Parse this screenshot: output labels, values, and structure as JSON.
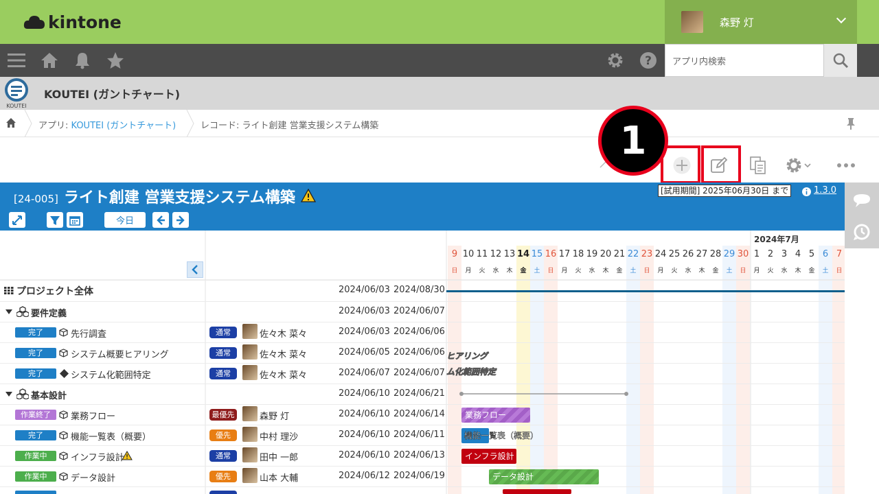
{
  "header": {
    "brand": "kintone",
    "user_name": "森野 灯"
  },
  "nav": {
    "search_placeholder": "アプリ内検索"
  },
  "app": {
    "title": "KOUTEI (ガントチャート)",
    "icon_label": "KOUTEI"
  },
  "breadcrumb": {
    "app_prefix": "アプリ: ",
    "app_link": "KOUTEI (ガントチャート)",
    "record": "レコード: ライト創建 営業支援システム構築"
  },
  "callout": {
    "number": "1"
  },
  "banner": {
    "record_id": "[24-005]",
    "title": "ライト創建 営業支援システム構築",
    "today_button": "今日",
    "trial_text": "[試用期間] 2025年06月30日 まで",
    "version": "1.3.0"
  },
  "gantt_header": {
    "month_label": "2024年7月",
    "days": [
      "9",
      "10",
      "11",
      "12",
      "13",
      "14",
      "15",
      "16",
      "17",
      "18",
      "19",
      "20",
      "21",
      "22",
      "23",
      "24",
      "25",
      "26",
      "27",
      "28",
      "29",
      "30",
      "1",
      "2",
      "3",
      "4",
      "5",
      "6",
      "7"
    ],
    "weekdays": [
      "日",
      "月",
      "火",
      "水",
      "木",
      "金",
      "土",
      "日",
      "月",
      "火",
      "水",
      "木",
      "金",
      "土",
      "日",
      "月",
      "火",
      "水",
      "木",
      "金",
      "土",
      "日",
      "月",
      "火",
      "水",
      "木",
      "金",
      "土",
      "日"
    ]
  },
  "rows": [
    {
      "name": "プロジェクト全体",
      "start": "2024/06/03",
      "end": "2024/08/30"
    },
    {
      "name": "要件定義",
      "start": "2024/06/03",
      "end": "2024/06/07"
    },
    {
      "status": "完了",
      "name": "先行調査",
      "priority": "通常",
      "person": "佐々木 菜々",
      "start": "2024/06/03",
      "end": "2024/06/06"
    },
    {
      "status": "完了",
      "name": "システム概要ヒアリング",
      "priority": "通常",
      "person": "佐々木 菜々",
      "start": "2024/06/05",
      "end": "2024/06/06"
    },
    {
      "status": "完了",
      "name": "システム化範囲特定",
      "priority": "通常",
      "person": "佐々木 菜々",
      "start": "2024/06/07",
      "end": "2024/06/07"
    },
    {
      "name": "基本設計",
      "start": "2024/06/10",
      "end": "2024/06/21"
    },
    {
      "status": "作業終了",
      "name": "業務フロー",
      "priority": "最優先",
      "person": "森野 灯",
      "start": "2024/06/10",
      "end": "2024/06/14"
    },
    {
      "status": "完了",
      "name": "機能一覧表（概要）",
      "priority": "優先",
      "person": "中村 理沙",
      "start": "2024/06/10",
      "end": "2024/06/11"
    },
    {
      "status": "作業中",
      "name": "インフラ設計",
      "priority": "通常",
      "person": "田中 一郎",
      "start": "2024/06/10",
      "end": "2024/06/13"
    },
    {
      "status": "作業中",
      "name": "データ設計",
      "priority": "優先",
      "person": "山本 大輔",
      "start": "2024/06/12",
      "end": "2024/06/19"
    }
  ],
  "bar_labels": {
    "hearing": "ヒアリング",
    "scope": "ム化範囲特定",
    "flow": "業務フロー",
    "func": "機能一覧表（概要）",
    "infra": "インフラ設計",
    "data": "データ設計"
  }
}
